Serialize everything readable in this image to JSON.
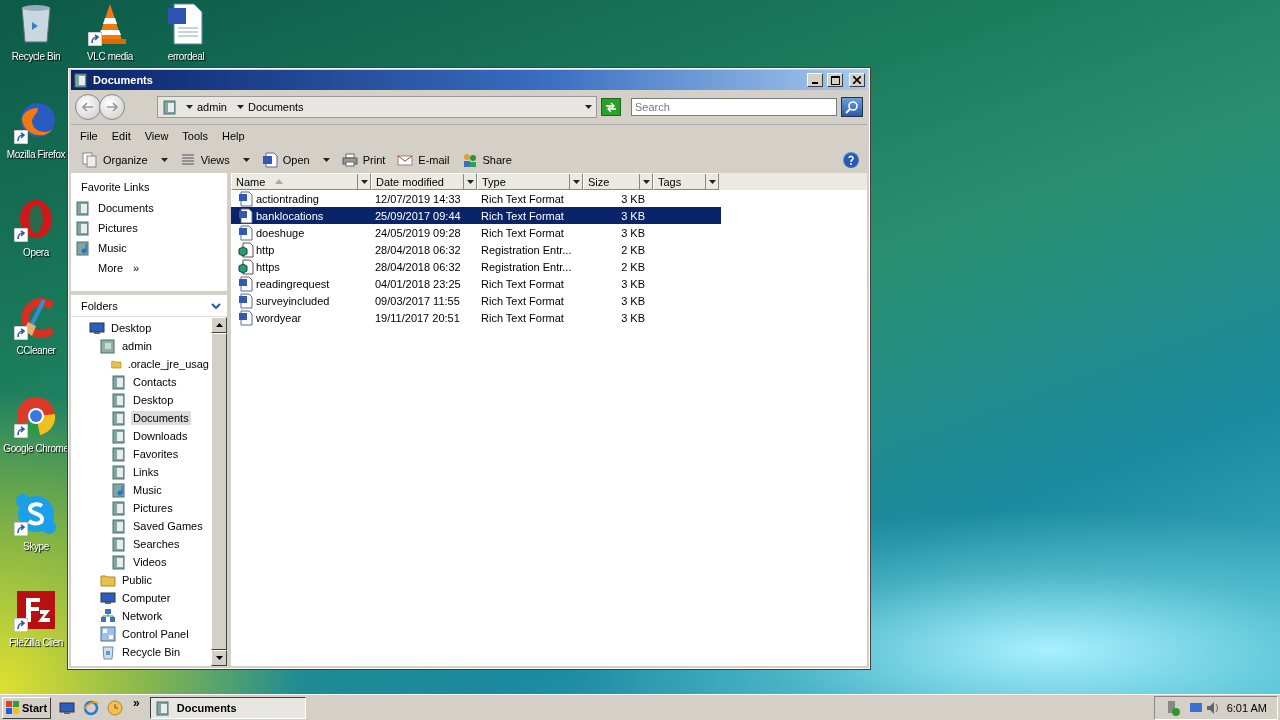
{
  "desktop_icons": [
    {
      "label": "Recycle Bin",
      "kind": "bin",
      "shortcut": false
    },
    {
      "label": "VLC media",
      "kind": "cone",
      "shortcut": true
    },
    {
      "label": "errordeal",
      "kind": "doc",
      "shortcut": false
    },
    {
      "label": "Mozilla Firefox",
      "kind": "fox",
      "shortcut": true
    },
    {
      "label": "Opera",
      "kind": "ring",
      "shortcut": true
    },
    {
      "label": "CCleaner",
      "kind": "brush",
      "shortcut": true
    },
    {
      "label": "Google Chrome",
      "kind": "wheel",
      "shortcut": true
    },
    {
      "label": "Skype",
      "kind": "bubble",
      "shortcut": true
    },
    {
      "label": "FileZilla Clien",
      "kind": "tile",
      "shortcut": true
    }
  ],
  "window": {
    "title": "Documents",
    "breadcrumbs": [
      "admin",
      "Documents"
    ],
    "search": {
      "placeholder": "Search"
    },
    "menu": [
      "File",
      "Edit",
      "View",
      "Tools",
      "Help"
    ],
    "toolbar": [
      {
        "label": "Organize",
        "kind": "organize",
        "dropdown": true
      },
      {
        "label": "Views",
        "kind": "views",
        "dropdown": true
      },
      {
        "label": "Open",
        "kind": "open",
        "dropdown": true
      },
      {
        "label": "Print",
        "kind": "print",
        "dropdown": false
      },
      {
        "label": "E-mail",
        "kind": "email",
        "dropdown": false
      },
      {
        "label": "Share",
        "kind": "share",
        "dropdown": false
      }
    ]
  },
  "favorite_links": {
    "title": "Favorite Links",
    "items": [
      {
        "label": "Documents",
        "kind": "library"
      },
      {
        "label": "Pictures",
        "kind": "library"
      },
      {
        "label": "Music",
        "kind": "music"
      }
    ],
    "more": "More",
    "more_glyph": "»"
  },
  "folders": {
    "title": "Folders",
    "tree": [
      {
        "label": "Desktop",
        "kind": "monitor",
        "selected": false,
        "children": [
          {
            "label": "admin",
            "kind": "user",
            "selected": false,
            "children": [
              {
                "label": ".oracle_jre_usag",
                "kind": "folder",
                "selected": false
              },
              {
                "label": "Contacts",
                "kind": "library",
                "selected": false
              },
              {
                "label": "Desktop",
                "kind": "library",
                "selected": false
              },
              {
                "label": "Documents",
                "kind": "library",
                "selected": true
              },
              {
                "label": "Downloads",
                "kind": "library",
                "selected": false
              },
              {
                "label": "Favorites",
                "kind": "library",
                "selected": false
              },
              {
                "label": "Links",
                "kind": "library",
                "selected": false
              },
              {
                "label": "Music",
                "kind": "music",
                "selected": false
              },
              {
                "label": "Pictures",
                "kind": "library",
                "selected": false
              },
              {
                "label": "Saved Games",
                "kind": "library",
                "selected": false
              },
              {
                "label": "Searches",
                "kind": "library",
                "selected": false
              },
              {
                "label": "Videos",
                "kind": "library",
                "selected": false
              }
            ]
          },
          {
            "label": "Public",
            "kind": "folder",
            "selected": false
          },
          {
            "label": "Computer",
            "kind": "monitor",
            "selected": false
          },
          {
            "label": "Network",
            "kind": "network",
            "selected": false
          },
          {
            "label": "Control Panel",
            "kind": "panel",
            "selected": false
          },
          {
            "label": "Recycle Bin",
            "kind": "bin",
            "selected": false
          }
        ]
      }
    ]
  },
  "files": {
    "columns": [
      {
        "label": "Name",
        "sorted": true
      },
      {
        "label": "Date modified",
        "sorted": false
      },
      {
        "label": "Type",
        "sorted": false
      },
      {
        "label": "Size",
        "sorted": false
      },
      {
        "label": "Tags",
        "sorted": false
      }
    ],
    "rows": [
      {
        "name": "actiontrading",
        "date": "12/07/2019 14:33",
        "type": "Rich Text Format",
        "size": "3 KB",
        "kind": "rtf",
        "selected": false
      },
      {
        "name": "banklocations",
        "date": "25/09/2017 09:44",
        "type": "Rich Text Format",
        "size": "3 KB",
        "kind": "rtf",
        "selected": true
      },
      {
        "name": "doeshuge",
        "date": "24/05/2019 09:28",
        "type": "Rich Text Format",
        "size": "3 KB",
        "kind": "rtf",
        "selected": false
      },
      {
        "name": "http",
        "date": "28/04/2018 06:32",
        "type": "Registration Entr...",
        "size": "2 KB",
        "kind": "reg",
        "selected": false
      },
      {
        "name": "https",
        "date": "28/04/2018 06:32",
        "type": "Registration Entr...",
        "size": "2 KB",
        "kind": "reg",
        "selected": false
      },
      {
        "name": "readingrequest",
        "date": "04/01/2018 23:25",
        "type": "Rich Text Format",
        "size": "3 KB",
        "kind": "rtf",
        "selected": false
      },
      {
        "name": "surveyincluded",
        "date": "09/03/2017 11:55",
        "type": "Rich Text Format",
        "size": "3 KB",
        "kind": "rtf",
        "selected": false
      },
      {
        "name": "wordyear",
        "date": "19/11/2017 20:51",
        "type": "Rich Text Format",
        "size": "3 KB",
        "kind": "rtf",
        "selected": false
      }
    ]
  },
  "taskbar": {
    "start": "Start",
    "chevron": "»",
    "tasks": [
      {
        "label": "Documents",
        "selected": true
      }
    ],
    "clock": "6:01 AM"
  }
}
